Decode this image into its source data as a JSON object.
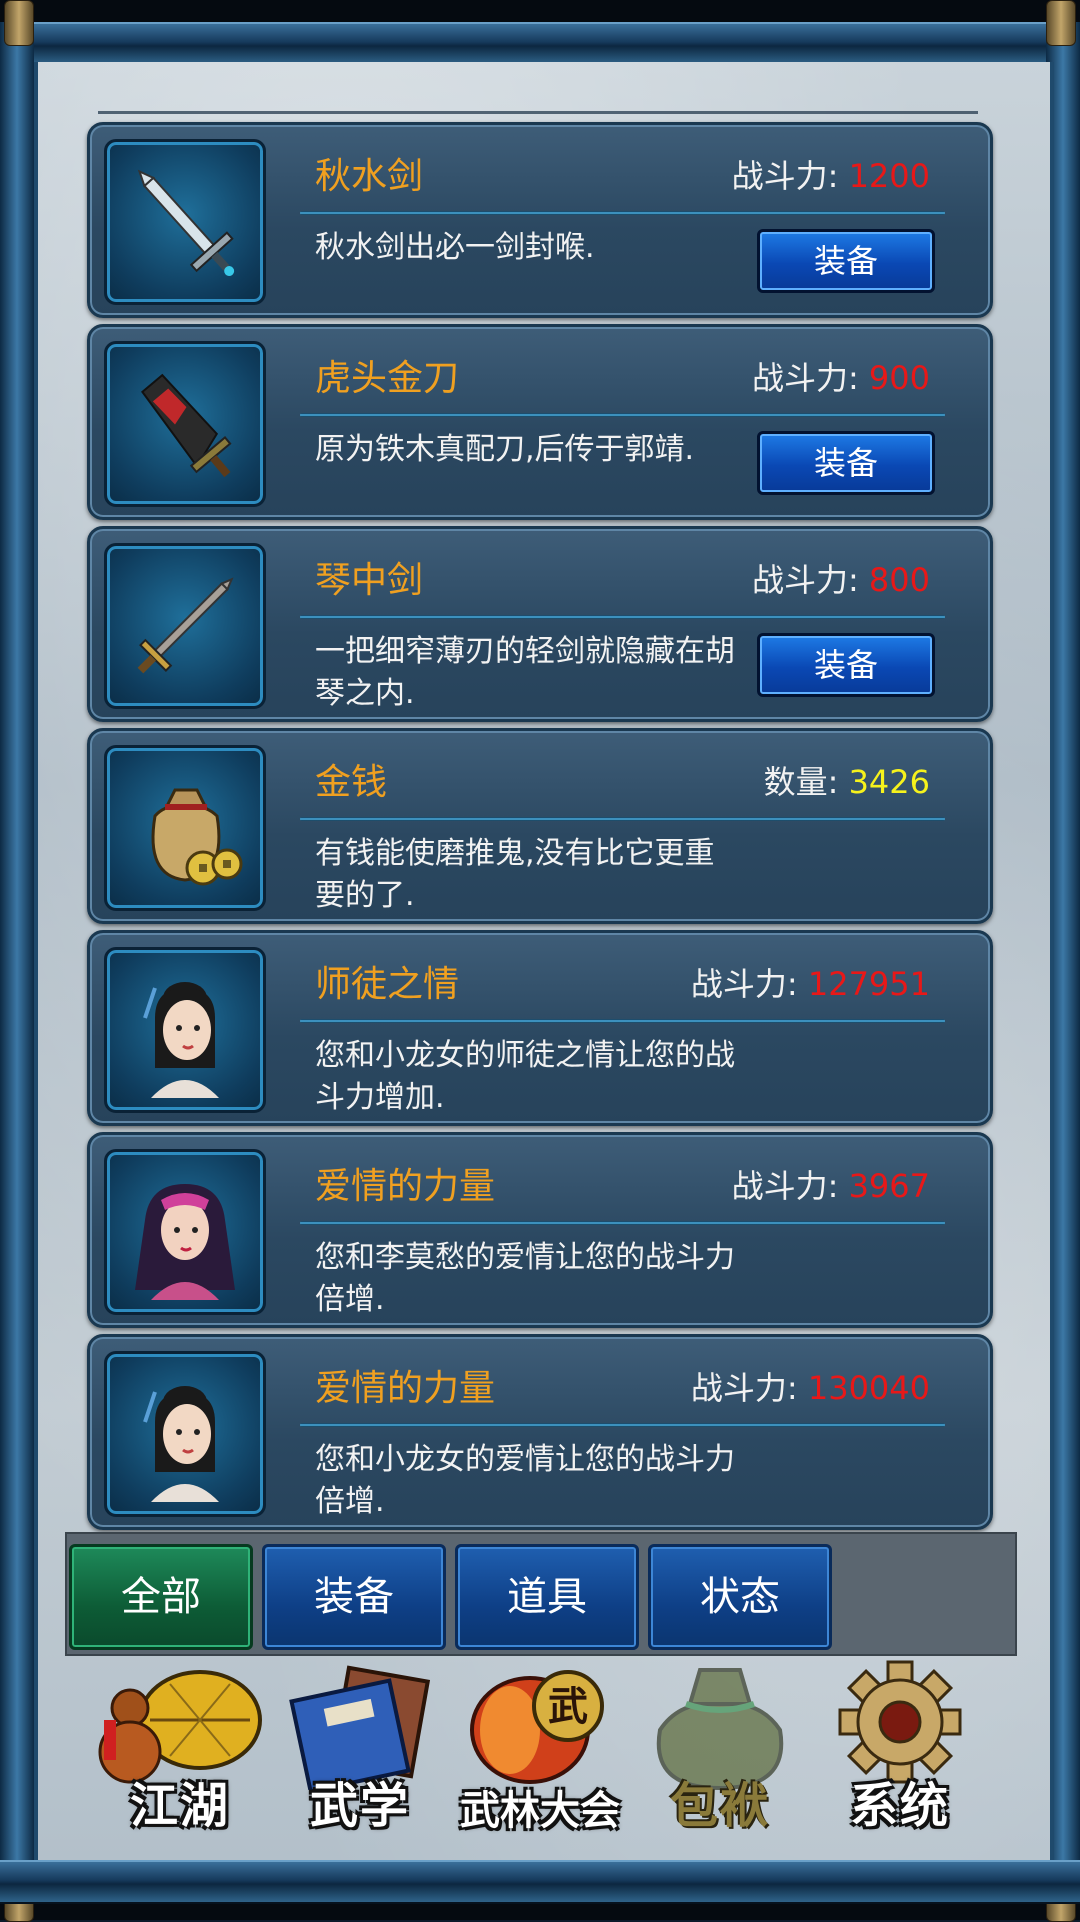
{
  "colors": {
    "name": "#f0a020",
    "power_value": "#e81818",
    "quantity_value": "#f6f21c",
    "equip_button": "#0a48b4",
    "active_tab": "#0d5c36"
  },
  "items": [
    {
      "name": "秋水剑",
      "stat_label": "战斗力:",
      "stat_value": "1200",
      "desc": "秋水剑出必一剑封喉.",
      "button": "装备",
      "icon": "sword-icon"
    },
    {
      "name": "虎头金刀",
      "stat_label": "战斗力:",
      "stat_value": "900",
      "desc": "原为铁木真配刀,后传于郭靖.",
      "button": "装备",
      "icon": "saber-icon"
    },
    {
      "name": "琴中剑",
      "stat_label": "战斗力:",
      "stat_value": "800",
      "desc": "一把细窄薄刃的轻剑就隐藏在胡琴之内.",
      "button": "装备",
      "icon": "thin-sword-icon"
    },
    {
      "name": "金钱",
      "stat_label": "数量:",
      "stat_value": "3426",
      "desc": "有钱能使磨推鬼,没有比它更重要的了.",
      "icon": "money-bag-icon"
    },
    {
      "name": "师徒之情",
      "stat_label": "战斗力:",
      "stat_value": "127951",
      "desc": "您和小龙女的师徒之情让您的战斗力增加.",
      "icon": "xiaolongnu-portrait-icon"
    },
    {
      "name": "爱情的力量",
      "stat_label": "战斗力:",
      "stat_value": "3967",
      "desc": "您和李莫愁的爱情让您的战斗力倍增.",
      "icon": "limochou-portrait-icon"
    },
    {
      "name": "爱情的力量",
      "stat_label": "战斗力:",
      "stat_value": "130040",
      "desc": "您和小龙女的爱情让您的战斗力倍增.",
      "icon": "xiaolongnu-portrait-icon"
    }
  ],
  "tabs": [
    {
      "label": "全部",
      "active": true
    },
    {
      "label": "装备",
      "active": false
    },
    {
      "label": "道具",
      "active": false
    },
    {
      "label": "状态",
      "active": false
    }
  ],
  "nav": [
    {
      "label": "江湖",
      "icon": "gourd-hat-icon"
    },
    {
      "label": "武学",
      "icon": "book-icon"
    },
    {
      "label": "武林大会",
      "icon": "drum-icon"
    },
    {
      "label": "包袱",
      "icon": "bag-icon",
      "active": true
    },
    {
      "label": "系统",
      "icon": "gear-icon"
    }
  ]
}
